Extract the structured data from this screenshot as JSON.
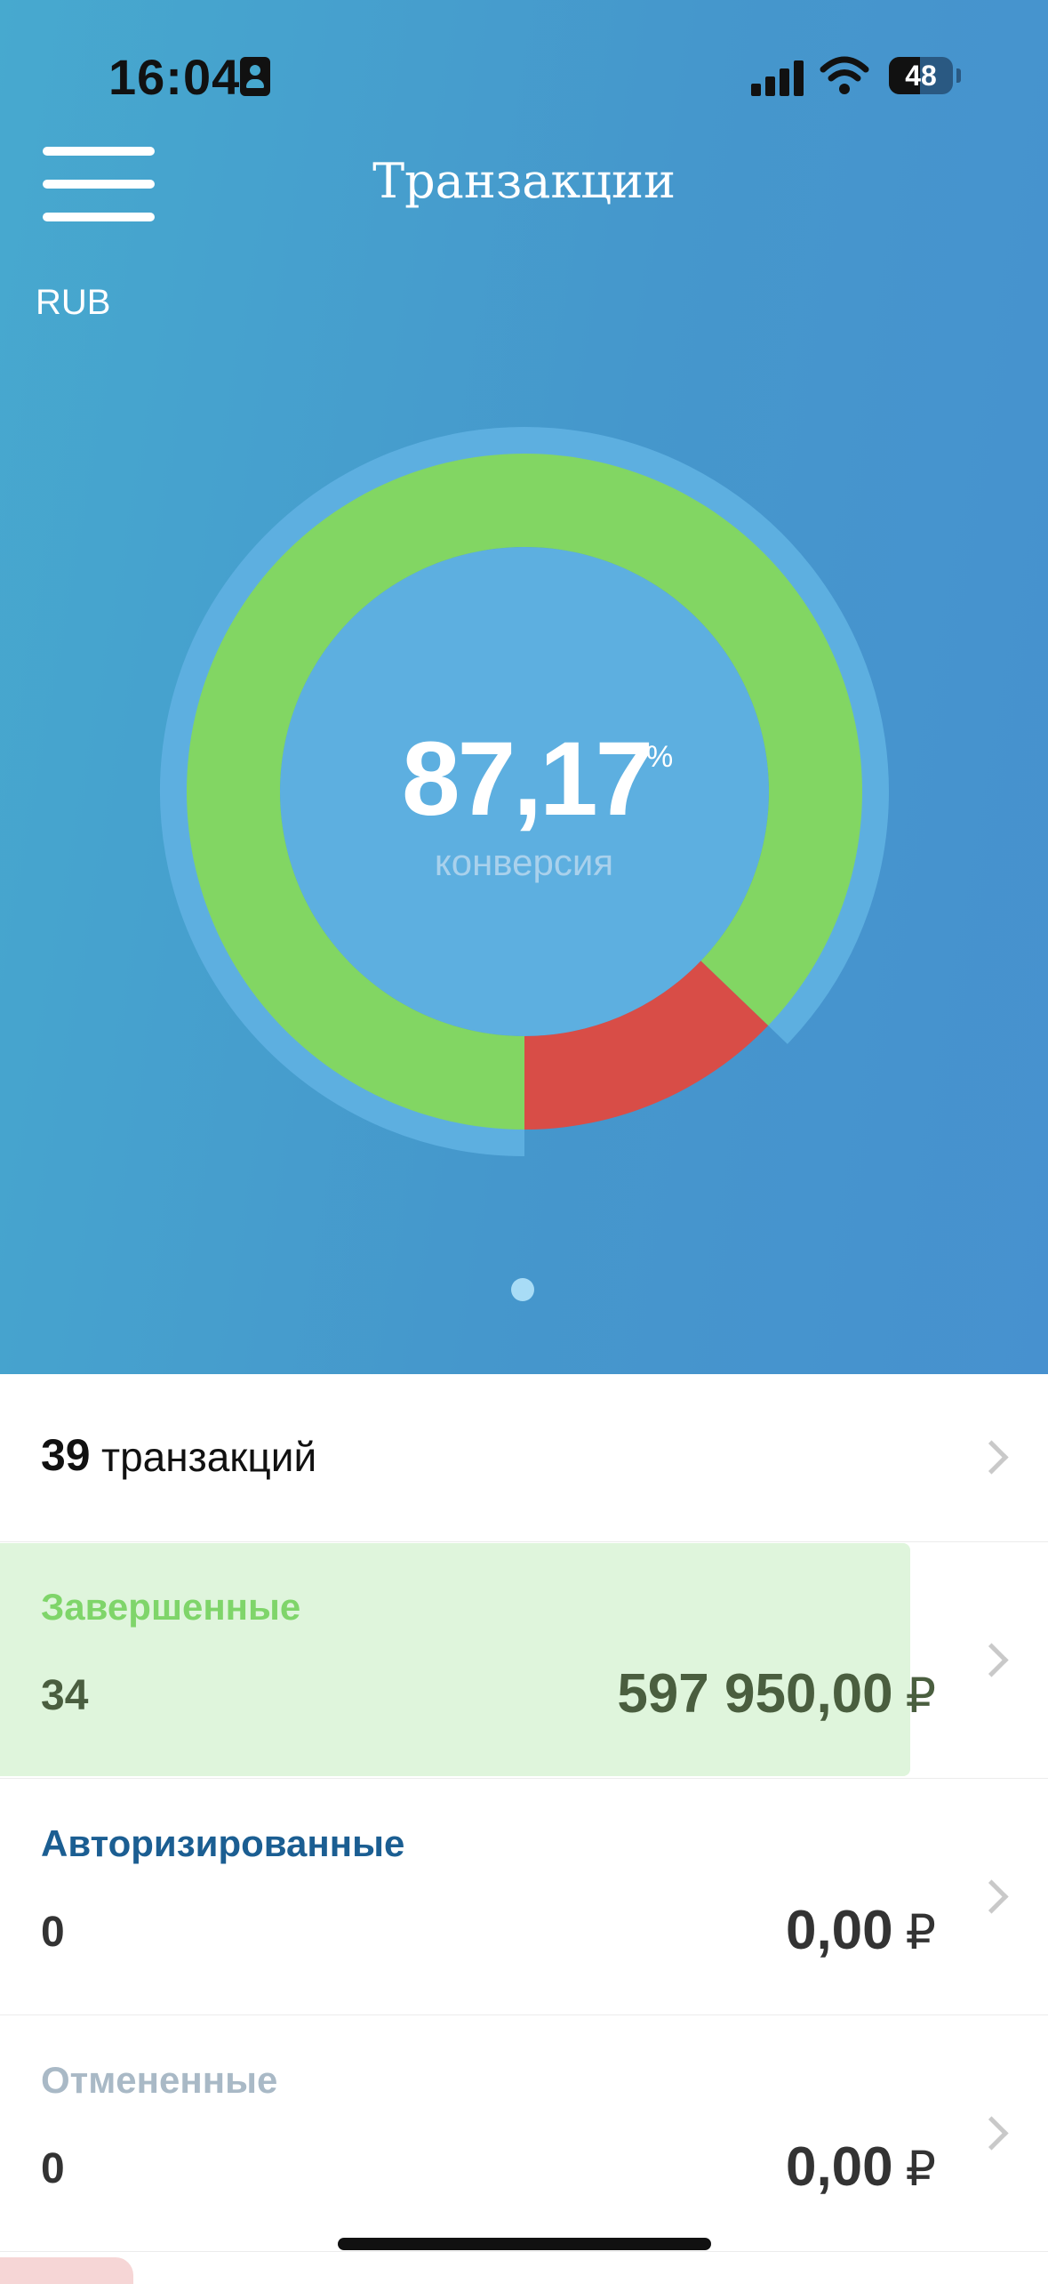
{
  "status_bar": {
    "time": "16:04",
    "battery": "48"
  },
  "header": {
    "title": "Транзакции",
    "currency": "RUB"
  },
  "conversion": {
    "value": "87,17",
    "unit": "%",
    "label": "конверсия",
    "completed_fraction": 0.8717
  },
  "chart_data": {
    "type": "pie",
    "categories": [
      "Завершенные",
      "Отмененные"
    ],
    "values": [
      87.17,
      12.83
    ],
    "colors": [
      "#82d663",
      "#d84d47"
    ]
  },
  "summary": {
    "count": "39",
    "label": "транзакций"
  },
  "rows": [
    {
      "label": "Завершенные",
      "count": "34",
      "amount": "597 950,00",
      "currency": "₽",
      "label_color": "#7fd56a",
      "value_color": "#4a5e3f",
      "fill": "#dff5dc",
      "fill_fraction": 1.0
    },
    {
      "label": "Авторизированные",
      "count": "0",
      "amount": "0,00",
      "currency": "₽",
      "label_color": "#1b5e92",
      "value_color": "#333333"
    },
    {
      "label": "Отмененные",
      "count": "0",
      "amount": "0,00",
      "currency": "₽",
      "label_color": "#a9b9c6",
      "value_color": "#333333"
    }
  ]
}
